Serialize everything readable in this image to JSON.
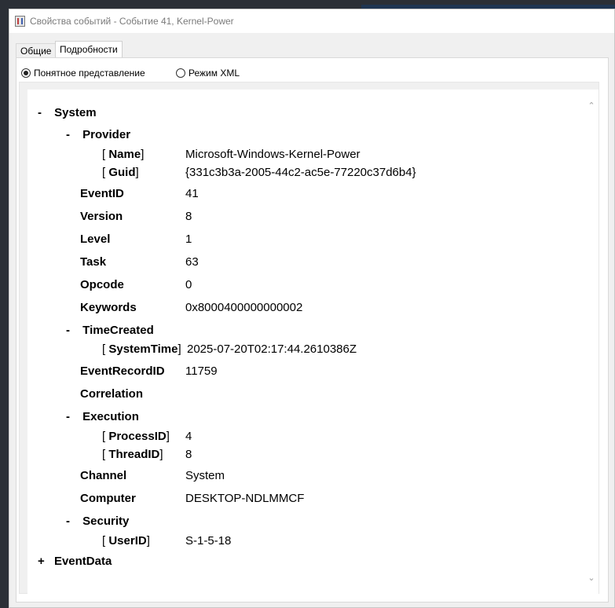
{
  "window": {
    "title": "Свойства событий - Событие 41, Kernel-Power"
  },
  "tabs": [
    {
      "label": "Общие",
      "active": false
    },
    {
      "label": "Подробности",
      "active": true
    }
  ],
  "view_mode": {
    "friendly_label": "Понятное представление",
    "xml_label": "Режим XML",
    "selected": "friendly"
  },
  "tree": {
    "system": {
      "toggle": "-",
      "label": "System"
    },
    "provider": {
      "toggle": "-",
      "label": "Provider"
    },
    "provider_name": {
      "open": "[",
      "key": "Name",
      "close": "]",
      "value": "Microsoft-Windows-Kernel-Power"
    },
    "provider_guid": {
      "open": "[",
      "key": "Guid",
      "close": "]",
      "value": "{331c3b3a-2005-44c2-ac5e-77220c37d6b4}"
    },
    "event_id": {
      "label": "EventID",
      "value": "41"
    },
    "version": {
      "label": "Version",
      "value": "8"
    },
    "level": {
      "label": "Level",
      "value": "1"
    },
    "task": {
      "label": "Task",
      "value": "63"
    },
    "opcode": {
      "label": "Opcode",
      "value": "0"
    },
    "keywords": {
      "label": "Keywords",
      "value": "0x8000400000000002"
    },
    "time_created": {
      "toggle": "-",
      "label": "TimeCreated"
    },
    "system_time": {
      "open": "[",
      "key": "SystemTime",
      "close": "]",
      "value": "2025-07-20T02:17:44.2610386Z"
    },
    "event_record_id": {
      "label": "EventRecordID",
      "value": "11759"
    },
    "correlation": {
      "label": "Correlation"
    },
    "execution": {
      "toggle": "-",
      "label": "Execution"
    },
    "process_id": {
      "open": "[",
      "key": "ProcessID",
      "close": "]",
      "value": "4"
    },
    "thread_id": {
      "open": "[",
      "key": "ThreadID",
      "close": "]",
      "value": "8"
    },
    "channel": {
      "label": "Channel",
      "value": "System"
    },
    "computer": {
      "label": "Computer",
      "value": "DESKTOP-NDLMMCF"
    },
    "security": {
      "toggle": "-",
      "label": "Security"
    },
    "user_id": {
      "open": "[",
      "key": "UserID",
      "close": "]",
      "value": "S-1-5-18"
    },
    "event_data": {
      "toggle": "+",
      "label": "EventData"
    }
  },
  "scrollbar": {
    "up_icon": "chevron-up-icon",
    "down_icon": "chevron-down-icon"
  }
}
